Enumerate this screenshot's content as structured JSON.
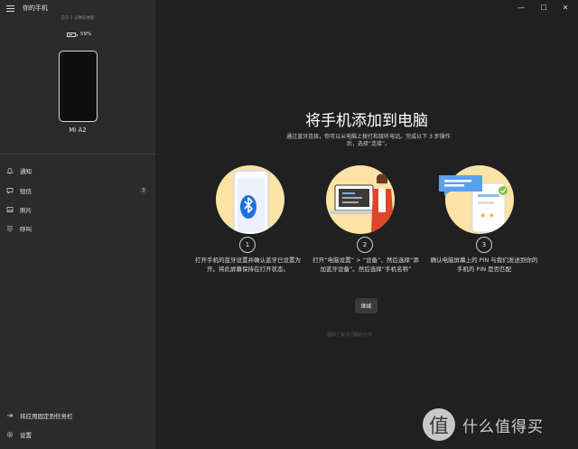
{
  "sidebar": {
    "app_title": "你的手机",
    "connection_status": "已于 1 分钟前更新",
    "battery_percent": "59%",
    "phone_name": "Mi A2",
    "nav": [
      {
        "label": "通知",
        "icon": "bell-icon"
      },
      {
        "label": "短信",
        "icon": "message-icon",
        "badge": "3"
      },
      {
        "label": "照片",
        "icon": "photo-icon"
      },
      {
        "label": "呼叫",
        "icon": "dialpad-icon"
      }
    ],
    "pin_label": "将应用固定到任务栏",
    "settings_label": "设置"
  },
  "window_controls": {
    "minimize": "—",
    "maximize": "☐",
    "close": "✕"
  },
  "main": {
    "title": "将手机添加到电脑",
    "description": "通过蓝牙连接，你可以从电脑上拨打和接听电话。完成以下 3 步操作后，选择“连接”。",
    "steps": [
      {
        "number": "1",
        "text": "打开手机的蓝牙设置并确认蓝牙已设置为开。将此屏幕保持在打开状态。",
        "icon": "bluetooth-phone-illustration"
      },
      {
        "number": "2",
        "text": "打开“电脑设置” > “设备”，然后选择“添加蓝牙设备”。然后选择“手机名称”",
        "icon": "person-laptop-illustration"
      },
      {
        "number": "3",
        "text": "确认电脑屏幕上的 PIN 与我们发送到你的手机的 PIN 是否匹配",
        "icon": "pin-match-illustration"
      }
    ],
    "continue_label": "继续",
    "help_link": "遇到了解决问题的办法"
  },
  "watermark": {
    "symbol": "值",
    "text": "什么值得买"
  },
  "colors": {
    "background": "#202020",
    "sidebar": "#2b2b2b",
    "accent_yellow": "#fbe3a5",
    "bluetooth_blue": "#1f6fe0",
    "person_red": "#e0452b"
  }
}
